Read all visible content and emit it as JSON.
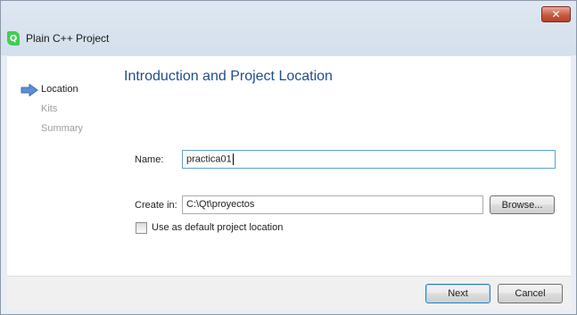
{
  "window": {
    "title": "Plain C++ Project",
    "close_glyph": "✕",
    "app_icon_glyph": "Q"
  },
  "steps": [
    {
      "label": "Location",
      "active": true
    },
    {
      "label": "Kits",
      "active": false
    },
    {
      "label": "Summary",
      "active": false
    }
  ],
  "page": {
    "title": "Introduction and Project Location"
  },
  "form": {
    "name_label": "Name:",
    "name_value": "practica01",
    "create_in_label": "Create in:",
    "create_in_value": "C:\\Qt\\proyectos",
    "browse_label": "Browse...",
    "default_location_label": "Use as default project location",
    "default_location_checked": false
  },
  "buttons": {
    "next_label": "Next",
    "cancel_label": "Cancel"
  },
  "colors": {
    "accent_title": "#1f4d8c",
    "step_arrow": "#5b8ed6"
  }
}
